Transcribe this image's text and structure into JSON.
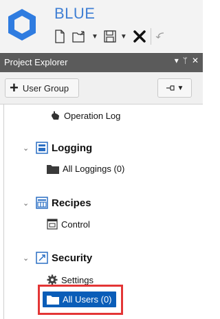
{
  "app": {
    "title": "BLUE"
  },
  "panel": {
    "title": "Project Explorer",
    "ctrl_dropdown": "▾",
    "ctrl_pin": "ᛘ",
    "ctrl_close": "✕"
  },
  "toolbar": {
    "add_label": "User Group"
  },
  "tree": {
    "operation_log": "Operation Log",
    "logging": "Logging",
    "all_loggings": "All Loggings (0)",
    "recipes": "Recipes",
    "control": "Control",
    "security": "Security",
    "settings": "Settings",
    "all_users": "All Users (0)"
  },
  "colors": {
    "accent": "#3f7fd4",
    "selection": "#0a5db8",
    "highlight": "#e33535",
    "panel_header": "#5b5b5b"
  },
  "icons": {
    "logo": "hexagon-logo-icon",
    "new": "new-document-icon",
    "open": "open-folder-icon",
    "save": "save-icon",
    "delete": "delete-x-icon",
    "undo": "undo-icon"
  }
}
